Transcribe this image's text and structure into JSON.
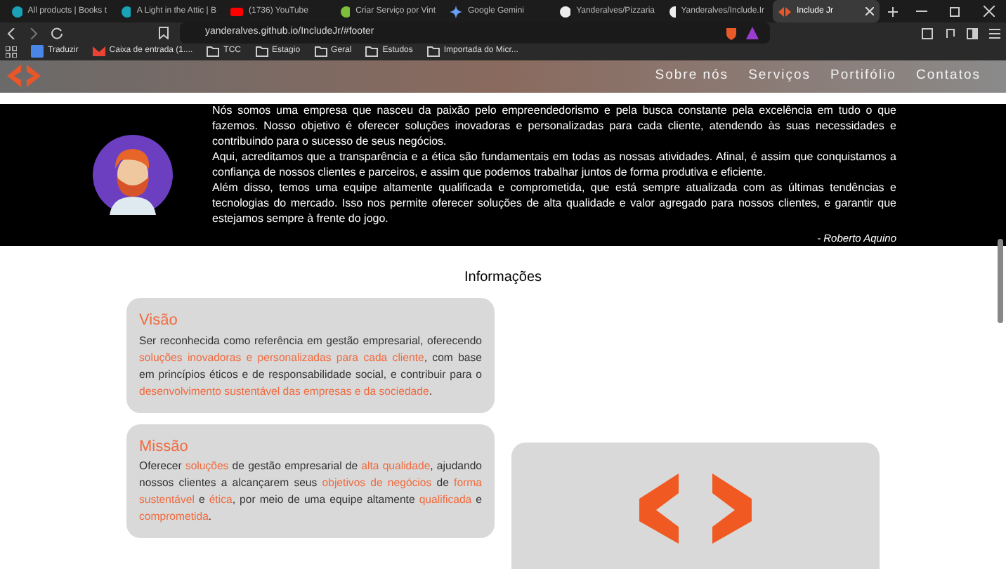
{
  "browser": {
    "tabs": [
      {
        "title": "All products | Books t",
        "selected": false
      },
      {
        "title": "A Light in the Attic | B",
        "selected": false
      },
      {
        "title": "(1736) YouTube",
        "selected": false
      },
      {
        "title": "Criar Serviço por Vint",
        "selected": false
      },
      {
        "title": "Google Gemini",
        "selected": false
      },
      {
        "title": "Yanderalves/Pizzaria",
        "selected": false
      },
      {
        "title": "Yanderalves/Include.Ir",
        "selected": false
      },
      {
        "title": "Include Jr",
        "selected": true
      }
    ],
    "address": "yanderalves.github.io/IncludeJr/#footer",
    "bookmarks": [
      "Traduzir",
      "Caixa de entrada (1....",
      "TCC",
      "Estagio",
      "Geral",
      "Estudos",
      "Importada do Micr..."
    ]
  },
  "nav": [
    "Sobre nós",
    "Serviços",
    "Portifólio",
    "Contatos"
  ],
  "about": {
    "paragraphs": [
      "Nós somos uma empresa que nasceu da paixão pelo empreendedorismo e pela busca constante pela excelência em tudo o que fazemos. Nosso objetivo é oferecer soluções inovadoras e personalizadas para cada cliente, atendendo às suas necessidades e contribuindo para o sucesso de seus negócios.",
      "Aqui, acreditamos que a transparência e a ética são fundamentais em todas as nossas atividades. Afinal, é assim que conquistamos a confiança de nossos clientes e parceiros, e assim que podemos trabalhar juntos de forma produtiva e eficiente.",
      "Além disso, temos uma equipe altamente qualificada e comprometida, que está sempre atualizada com as últimas tendências e tecnologias do mercado. Isso nos permite oferecer soluções de alta qualidade e valor agregado para nossos clientes, e garantir que estejamos sempre à frente do jogo."
    ],
    "signature": "- Roberto Aquino"
  },
  "info": {
    "heading": "Informações",
    "cards": [
      {
        "title": "Visão",
        "segments": [
          {
            "text": "Ser reconhecida como referência em gestão empresarial, oferecendo ",
            "highlight": false
          },
          {
            "text": "soluções inovadoras e personalizadas para cada cliente",
            "highlight": true
          },
          {
            "text": ", com base em princípios éticos e de responsabilidade social, e contribuir para o ",
            "highlight": false
          },
          {
            "text": "desenvolvimento sustentável das empresas e da sociedade",
            "highlight": true
          },
          {
            "text": ".",
            "highlight": false
          }
        ]
      },
      {
        "title": "Missão",
        "segments": [
          {
            "text": "Oferecer ",
            "highlight": false
          },
          {
            "text": "soluções",
            "highlight": true
          },
          {
            "text": " de gestão empresarial de ",
            "highlight": false
          },
          {
            "text": "alta qualidade",
            "highlight": true
          },
          {
            "text": ", ajudando nossos clientes a alcançarem seus ",
            "highlight": false
          },
          {
            "text": "objetivos de negócios",
            "highlight": true
          },
          {
            "text": " de ",
            "highlight": false
          },
          {
            "text": "forma sustentável",
            "highlight": true
          },
          {
            "text": " e ",
            "highlight": false
          },
          {
            "text": "ética",
            "highlight": true
          },
          {
            "text": ", por meio de uma equipe altamente ",
            "highlight": false
          },
          {
            "text": "qualificada",
            "highlight": true
          },
          {
            "text": " e ",
            "highlight": false
          },
          {
            "text": "comprometida",
            "highlight": true
          },
          {
            "text": ".",
            "highlight": false
          }
        ]
      }
    ]
  }
}
